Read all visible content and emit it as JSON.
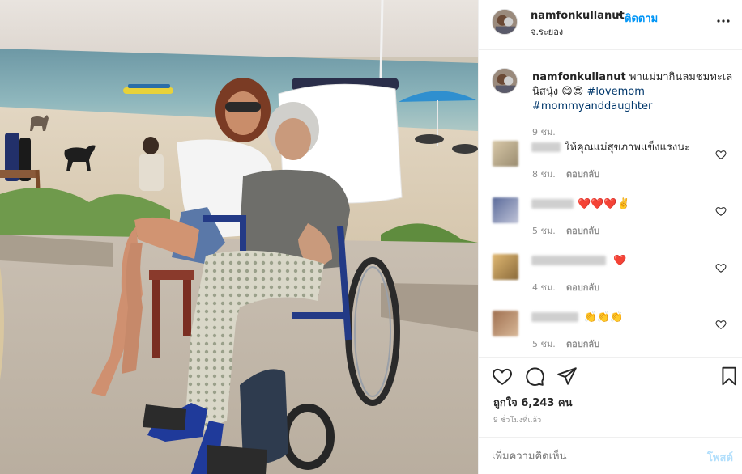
{
  "header": {
    "username": "namfonkullanut",
    "dot": "•",
    "follow_label": "ติดตาม",
    "location": "จ.ระยอง"
  },
  "caption": {
    "username": "namfonkullanut",
    "text": "พาแม่มากินลมชมทะเลนิสนุ๋ง 😋😍",
    "hashtag1": "#lovemom",
    "hashtag2": "#mommyanddaughter",
    "time": "9 ชม."
  },
  "comments": [
    {
      "text": "ให้คุณแม่สุขภาพแข็งแรงนะ",
      "time": "8 ชม.",
      "reply_label": "ตอบกลับ"
    },
    {
      "text": "❤️❤️❤️✌️",
      "time": "5 ชม.",
      "reply_label": "ตอบกลับ"
    },
    {
      "text": "❤️",
      "time": "4 ชม.",
      "reply_label": "ตอบกลับ"
    },
    {
      "text": "👏👏👏",
      "time": "5 ชม.",
      "reply_label": "ตอบกลับ"
    }
  ],
  "likes": "ถูกใจ 6,243 คน",
  "post_time": "9 ชั่วโมงที่แล้ว",
  "add_comment": {
    "placeholder": "เพิ่มความคิดเห็น",
    "post_label": "โพสต์"
  },
  "icons": {
    "more": "more-horizontal-icon",
    "like": "heart-outline-icon",
    "comment": "speech-bubble-icon",
    "share": "paper-plane-icon",
    "save": "bookmark-icon"
  },
  "colors": {
    "link_blue": "#0095f6",
    "hashtag": "#00376b",
    "muted": "#8e8e8e",
    "heart_red": "#ed4956"
  }
}
